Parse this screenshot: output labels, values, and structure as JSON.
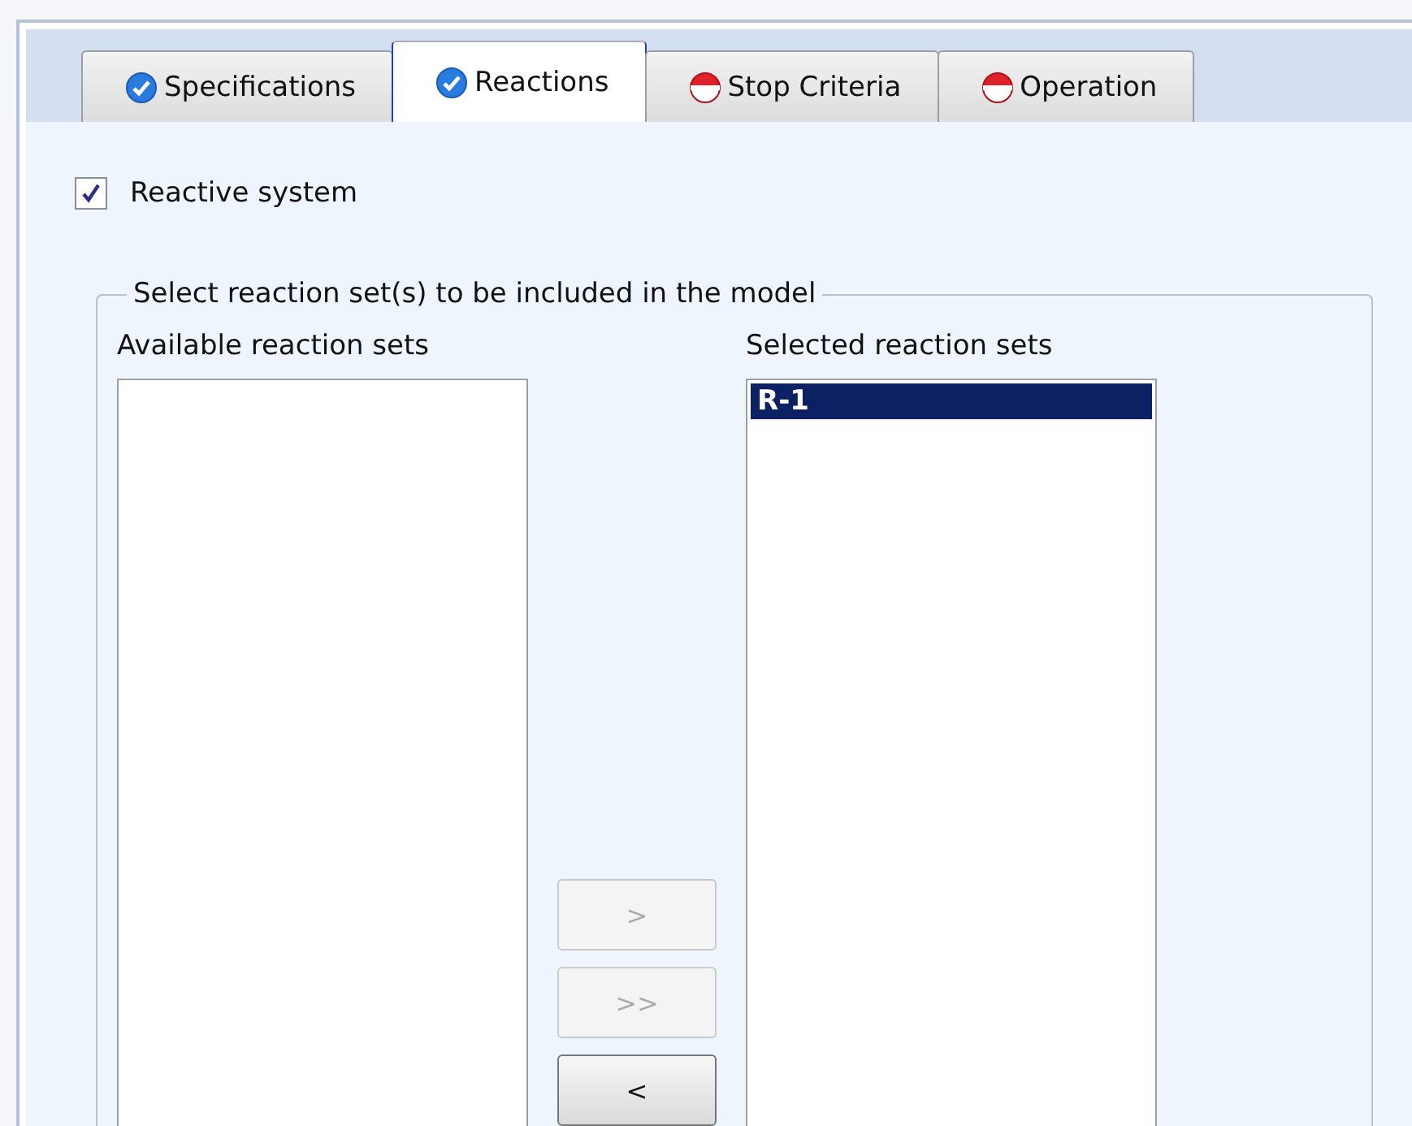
{
  "tabs": [
    {
      "label": "Specifications",
      "complete": true,
      "selected": false
    },
    {
      "label": "Reactions",
      "complete": true,
      "selected": true
    },
    {
      "label": "Stop Criteria",
      "complete": false,
      "selected": false
    },
    {
      "label": "Operation",
      "complete": false,
      "selected": false
    }
  ],
  "reactive_system": {
    "label": "Reactive system",
    "checked": true
  },
  "group": {
    "title": "Select reaction set(s) to be included in the model",
    "available": {
      "label": "Available reaction sets"
    },
    "selected": {
      "label": "Selected reaction sets",
      "items": [
        {
          "label": "R-1",
          "selected": true
        }
      ]
    },
    "buttons": [
      {
        "label": ">",
        "disabled": true
      },
      {
        "label": ">>",
        "disabled": true
      },
      {
        "label": "<",
        "disabled": false
      }
    ]
  }
}
